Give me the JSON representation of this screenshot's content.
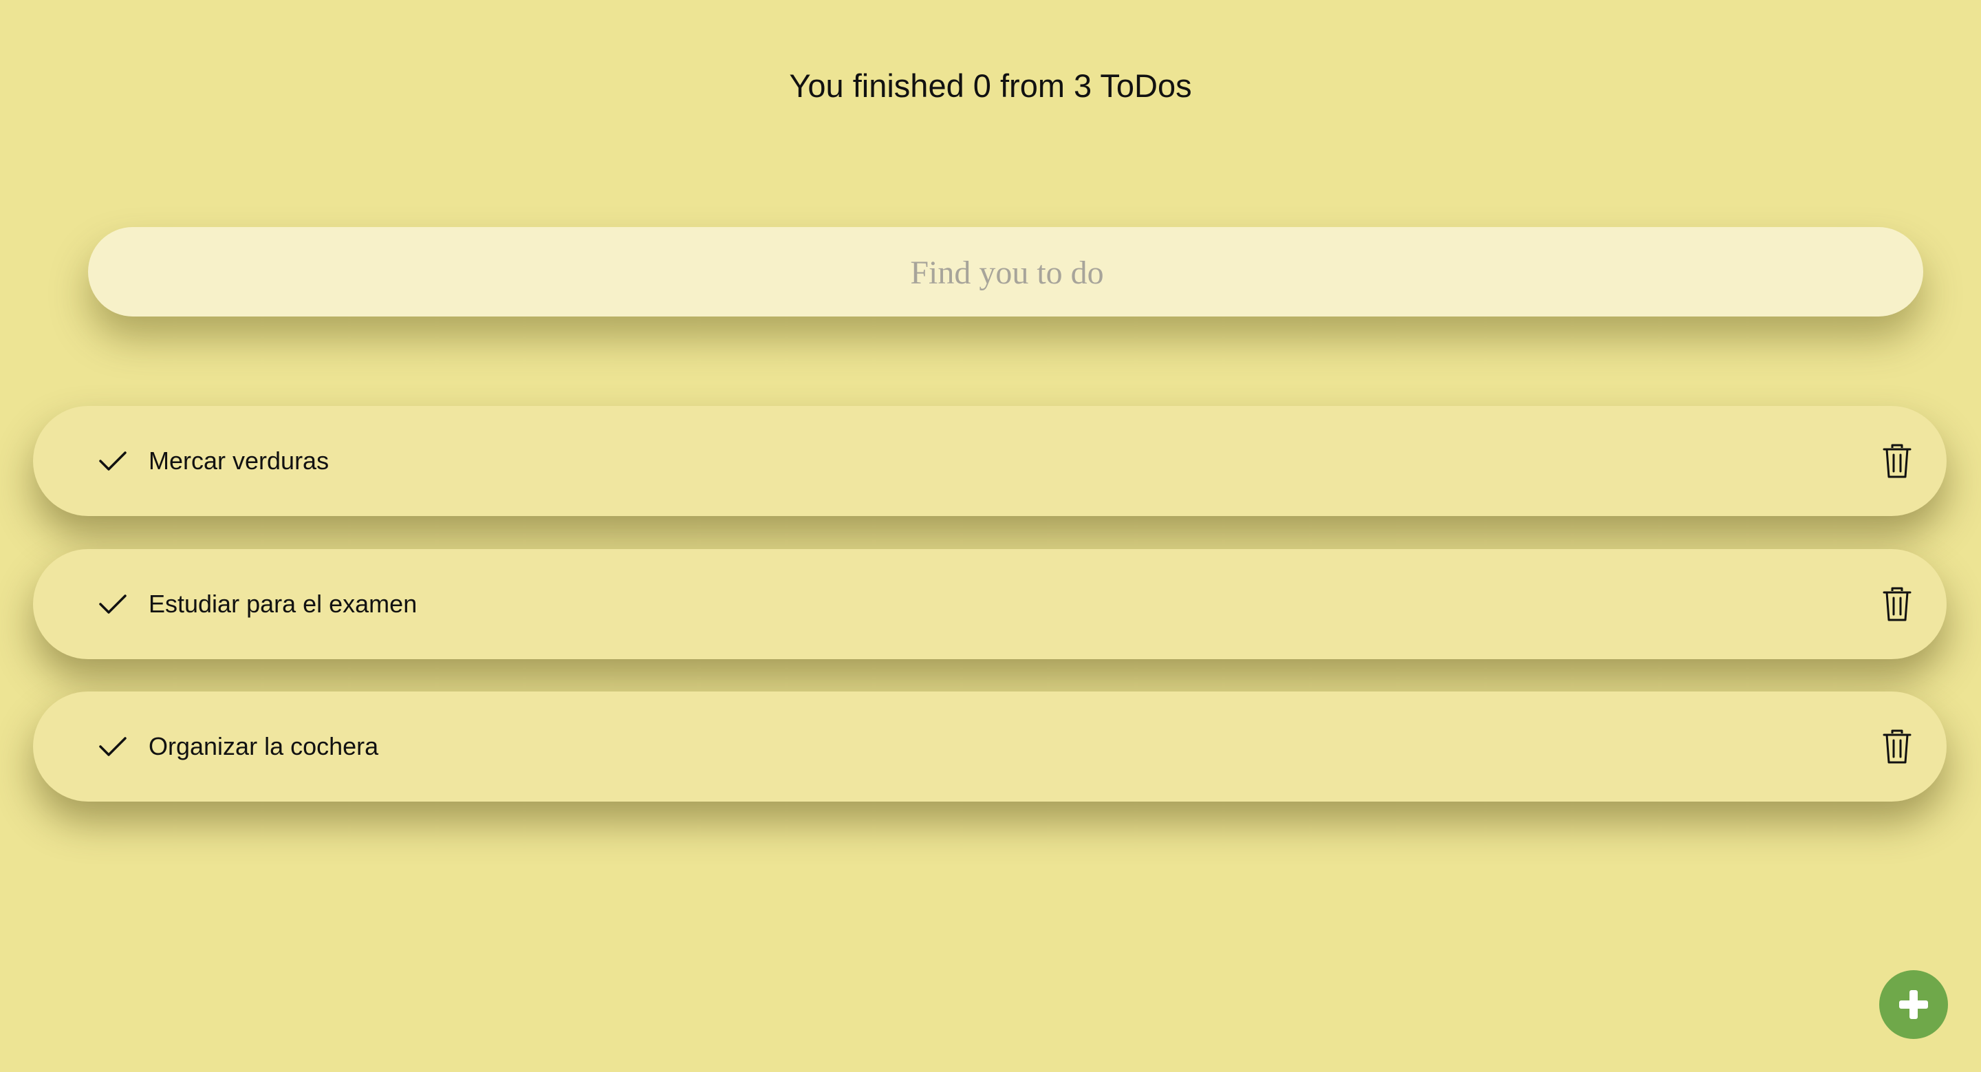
{
  "header": {
    "counter_text": "You finished 0 from 3 ToDos"
  },
  "search": {
    "placeholder": "Find you to do",
    "value": ""
  },
  "todos": [
    {
      "text": "Mercar verduras",
      "completed": false
    },
    {
      "text": "Estudiar para el examen",
      "completed": false
    },
    {
      "text": "Organizar la cochera",
      "completed": false
    }
  ],
  "icons": {
    "complete": "check-icon",
    "delete": "trash-icon",
    "add": "plus-icon"
  },
  "colors": {
    "background": "#ede494",
    "search_background": "#f7f1c9",
    "item_background": "#f0e6a0",
    "add_button": "#6fa84a"
  }
}
